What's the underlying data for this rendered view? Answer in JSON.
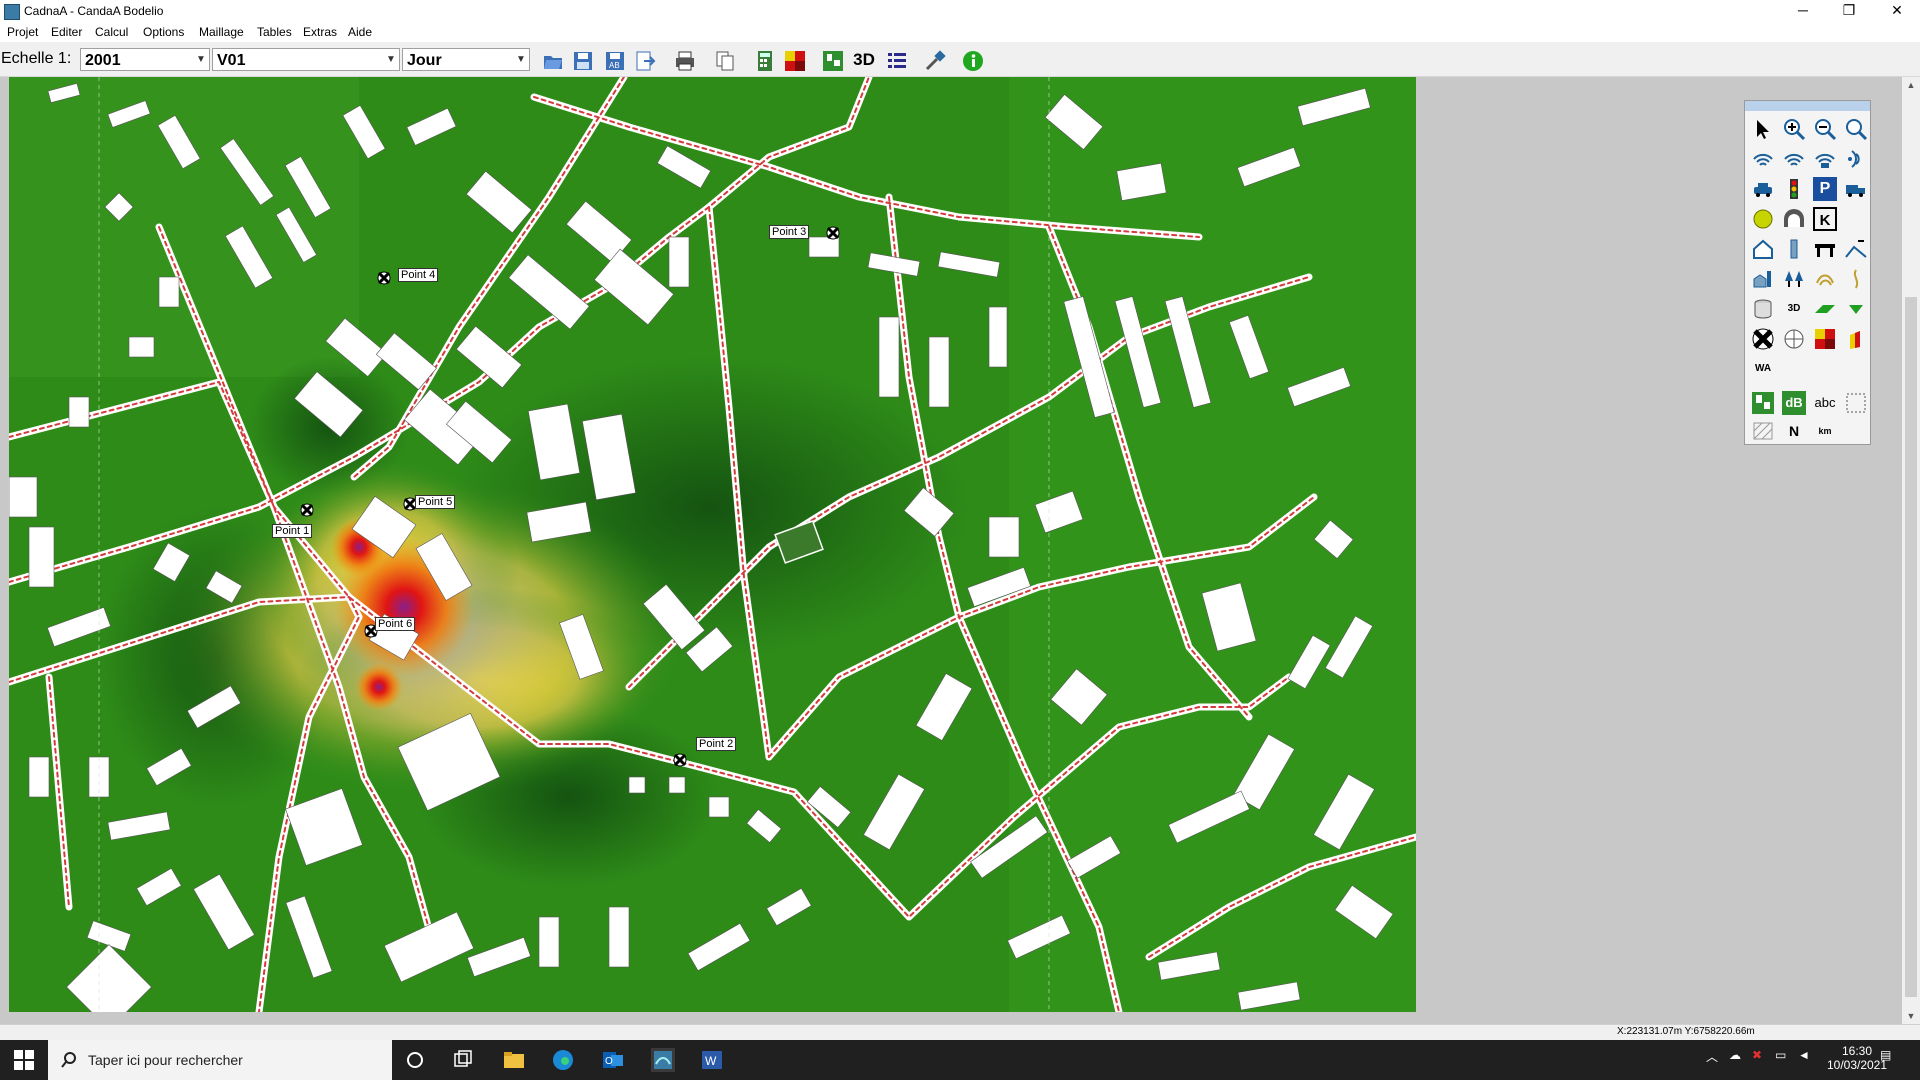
{
  "window": {
    "title": "CadnaA - CandaA Bodelio",
    "minimize_glyph": "─",
    "restore_glyph": "❐",
    "close_glyph": "✕"
  },
  "menu": [
    "Projet",
    "Editer",
    "Calcul",
    "Options",
    "Maillage",
    "Tables",
    "Extras",
    "Aide"
  ],
  "toolbar": {
    "scale_label": "Echelle 1:",
    "scale_value": "2001",
    "variant_value": "V01",
    "period_value": "Jour",
    "text_3d": "3D",
    "icons": [
      "open-icon",
      "save-icon",
      "save-as-icon",
      "export-icon",
      "print-icon",
      "copy-icon",
      "calculator-icon",
      "grid-map-icon",
      "3d-view-icon",
      "list-icon",
      "tool-icon",
      "info-icon"
    ]
  },
  "map": {
    "points": [
      {
        "label": "Point 1"
      },
      {
        "label": "Point 2"
      },
      {
        "label": "Point 3"
      },
      {
        "label": "Point 4"
      },
      {
        "label": "Point 5"
      },
      {
        "label": "Point 6"
      }
    ]
  },
  "palette": {
    "text_wa": "WA",
    "text_db": "dB",
    "text_abc": "abc",
    "text_km": "km",
    "text_3d": "3D",
    "text_p": "P",
    "text_k": "K",
    "text_n": "N"
  },
  "statusbar": {
    "coordinates": "X:223131.07m Y:6758220.66m"
  },
  "taskbar": {
    "search_placeholder": "Taper ici pour rechercher",
    "time": "16:30",
    "date": "10/03/2021"
  },
  "colors": {
    "grass": "#2e8b18",
    "building": "#ffffff",
    "road": "#d23c3c",
    "hot": "#e01414",
    "warm": "#ffe020",
    "gray": "#a6a69c"
  }
}
